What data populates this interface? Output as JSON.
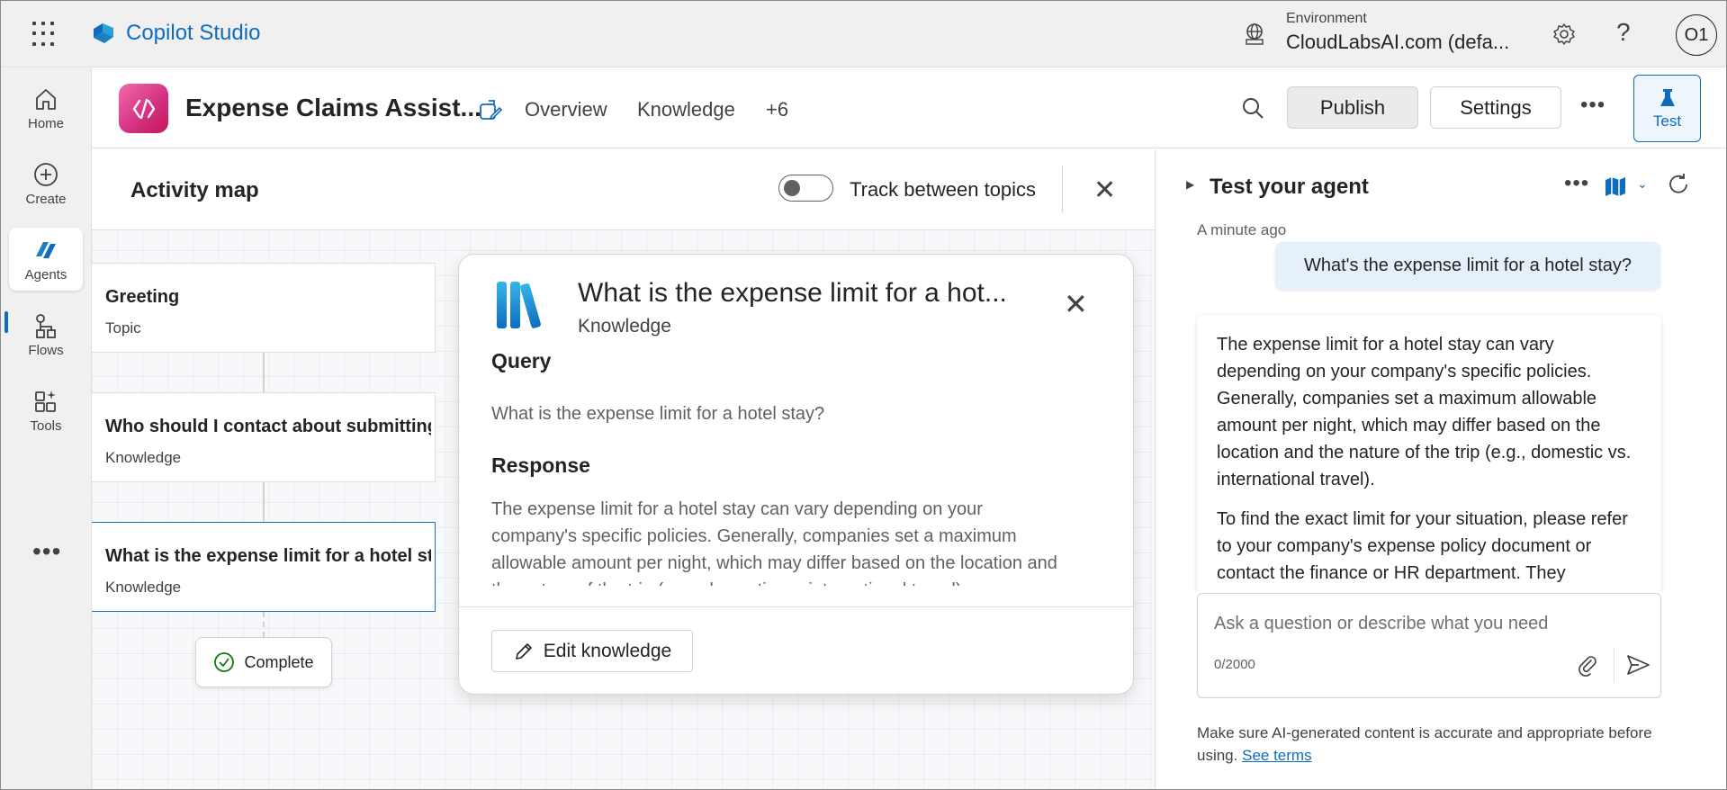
{
  "app": {
    "name": "Copilot Studio",
    "environment_label": "Environment",
    "environment_value": "CloudLabsAI.com (defa...",
    "avatar_initials": "O1"
  },
  "nav": {
    "items": [
      {
        "label": "Home",
        "icon": "home-icon"
      },
      {
        "label": "Create",
        "icon": "create-icon"
      },
      {
        "label": "Agents",
        "icon": "agents-icon"
      },
      {
        "label": "Flows",
        "icon": "flows-icon"
      },
      {
        "label": "Tools",
        "icon": "tools-icon"
      }
    ],
    "more": "•••"
  },
  "agent": {
    "name": "Expense Claims Assist...",
    "tabs": {
      "overview": "Overview",
      "knowledge": "Knowledge",
      "more": "+6"
    },
    "publish": "Publish",
    "settings": "Settings",
    "more": "•••",
    "test": "Test"
  },
  "activity": {
    "title": "Activity map",
    "toggle_label": "Track between topics",
    "nodes": [
      {
        "title": "Greeting",
        "sub": "Topic"
      },
      {
        "title": "Who should I contact about submitting expense claims?",
        "sub": "Knowledge"
      },
      {
        "title": "What is the expense limit for a hotel stay?",
        "sub": "Knowledge"
      }
    ],
    "complete": "Complete"
  },
  "card": {
    "title": "What is the expense limit for a hot...",
    "sub": "Knowledge",
    "query_heading": "Query",
    "query": "What is the expense limit for a hotel stay?",
    "response_heading": "Response",
    "response": "The expense limit for a hotel stay can vary depending on your company's specific policies. Generally, companies set a maximum allowable amount per night, which may differ based on the location and the nature of the trip (e.g., domestic vs. international travel).",
    "edit": "Edit knowledge"
  },
  "test": {
    "title": "Test your agent",
    "more": "•••",
    "timestamp": "A minute ago",
    "user_message": "What's the expense limit for a hotel stay?",
    "bot_p1": "The expense limit for a hotel stay can vary depending on your company's specific policies. Generally, companies set a maximum allowable amount per night, which may differ based on the location and the nature of the trip (e.g., domestic vs. international travel).",
    "bot_p2": "To find the exact limit for your situation, please refer to your company's expense policy document or contact the finance or HR department. They",
    "placeholder": "Ask a question or describe what you need",
    "count": "0/2000",
    "disclaimer": "Make sure AI-generated content is accurate and appropriate before using.",
    "terms": "See terms"
  },
  "colors": {
    "accent": "#0f6cbd",
    "agent_logo": "#d63384"
  }
}
